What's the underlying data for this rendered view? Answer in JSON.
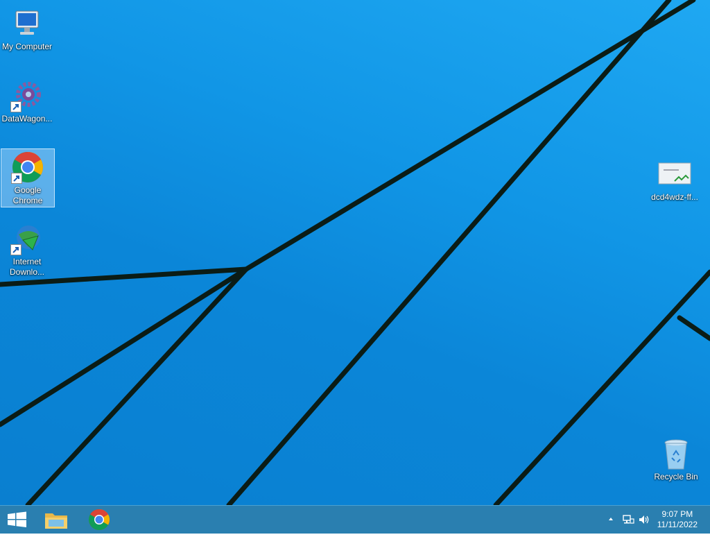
{
  "desktop_icons": {
    "my_computer": {
      "label": "My Computer",
      "icon": "computer-icon"
    },
    "datawagon": {
      "label": "DataWagon...",
      "icon": "gear-icon"
    },
    "google_chrome": {
      "label": "Google Chrome",
      "icon": "chrome-icon"
    },
    "internet_download": {
      "label": "Internet Downlo...",
      "icon": "internet-download-manager-icon"
    },
    "image_file": {
      "label": "dcd4wdz-ff...",
      "icon": "image-file-icon"
    },
    "recycle_bin": {
      "label": "Recycle Bin",
      "icon": "recycle-bin-icon"
    }
  },
  "taskbar": {
    "start": {
      "icon": "windows-logo-icon"
    },
    "pinned": [
      {
        "name": "File Explorer",
        "icon": "folder-icon"
      },
      {
        "name": "Google Chrome",
        "icon": "chrome-icon"
      }
    ],
    "tray": {
      "overflow_icon": "chevron-up-icon",
      "network_icon": "network-icon",
      "volume_icon": "speaker-icon"
    },
    "clock": {
      "time": "9:07 PM",
      "date": "11/11/2022"
    }
  },
  "colors": {
    "desktop_blue": "#1196e6",
    "taskbar": "#2a7fb0",
    "wallpaper_lines": "#0a1a14"
  }
}
